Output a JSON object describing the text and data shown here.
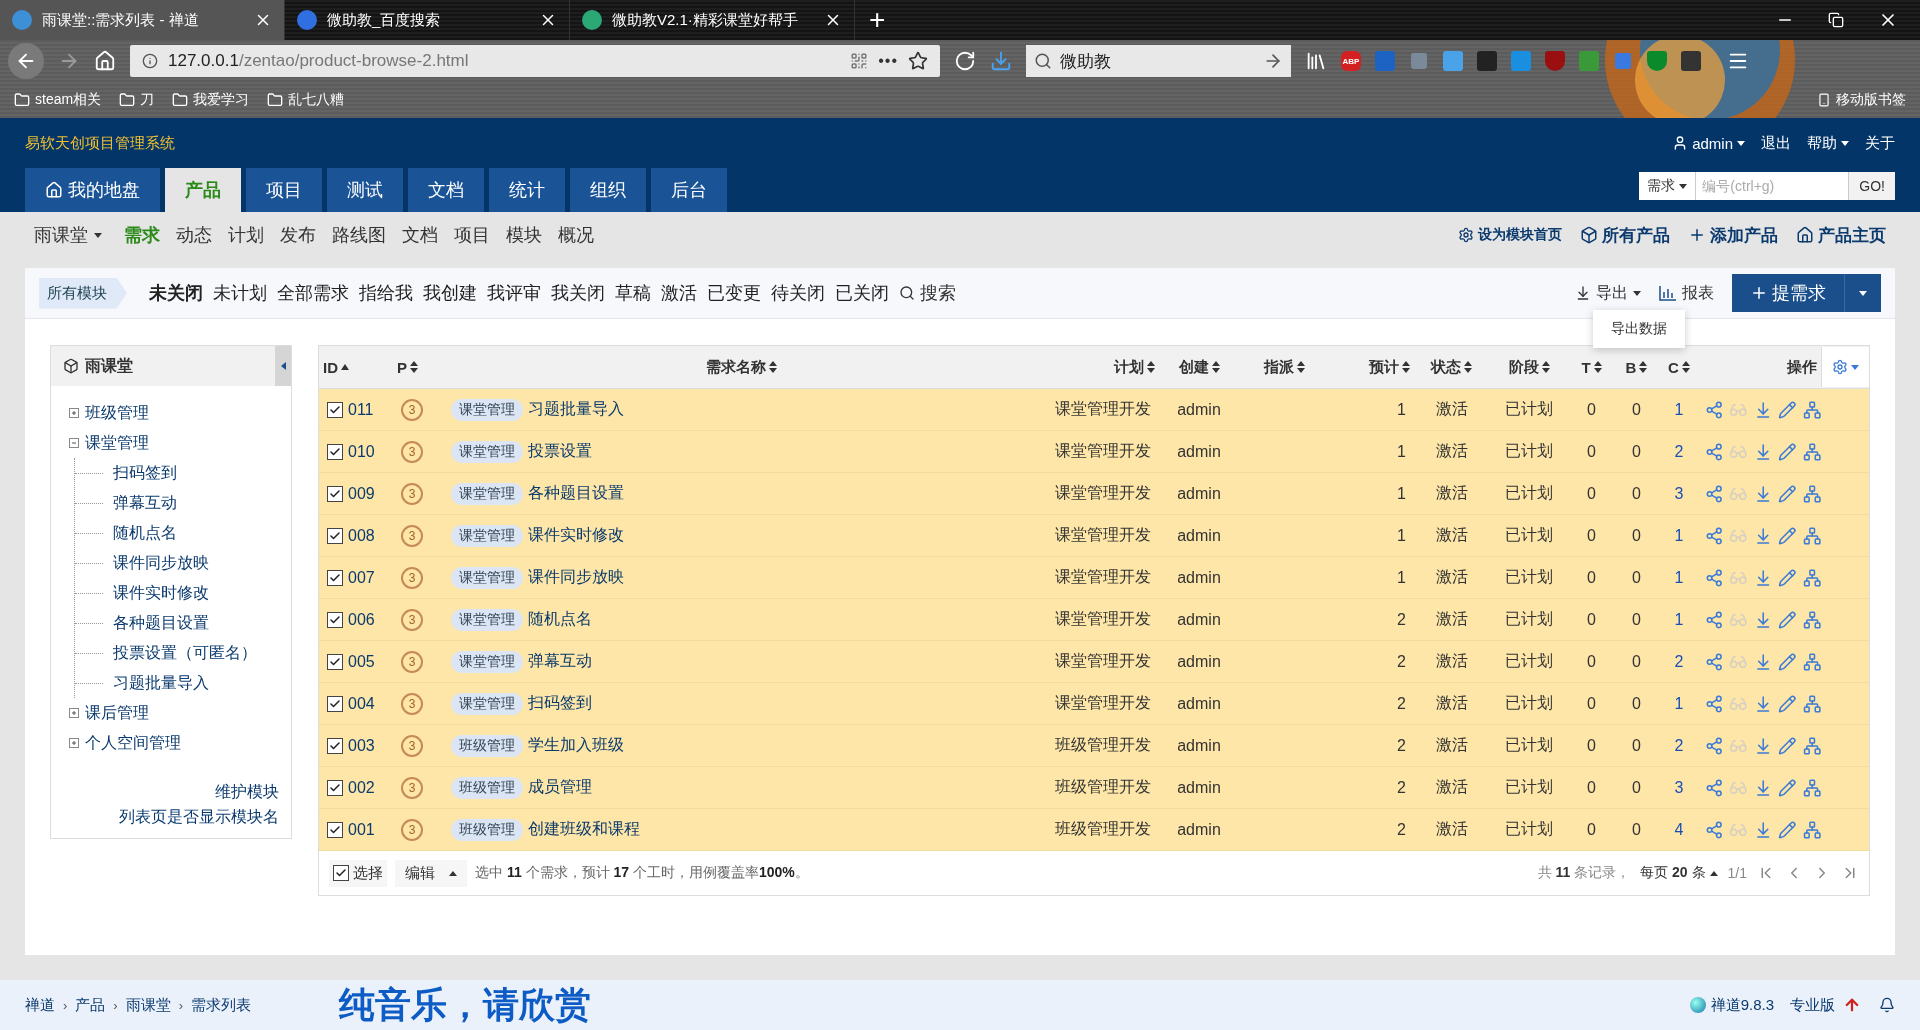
{
  "browser": {
    "tabs": [
      {
        "title": "雨课堂::需求列表 - 禅道",
        "selected": true,
        "color": "#3d8fd6"
      },
      {
        "title": "微助教_百度搜索",
        "selected": false,
        "color": "#2f6fe0"
      },
      {
        "title": "微助教V2.1·精彩课堂好帮手",
        "selected": false,
        "color": "#2aa876"
      }
    ],
    "new_tab": "+",
    "url_host": "127.0.0.1",
    "url_path": "/zentao/product-browse-2.html",
    "more": "•••",
    "search_value": "微助教",
    "extensions": [
      {
        "kind": "abp",
        "label": "ABP",
        "color": "#d32020"
      },
      {
        "kind": "tile",
        "color": "#1d63c4"
      },
      {
        "kind": "faded",
        "color": "#7a8a9a"
      },
      {
        "kind": "tile",
        "color": "#4aa3e8"
      },
      {
        "kind": "tile",
        "color": "#222222"
      },
      {
        "kind": "tile",
        "color": "#1a8fe0"
      },
      {
        "kind": "shield",
        "color": "#9a1010"
      },
      {
        "kind": "tile",
        "color": "#3a9a3a"
      },
      {
        "kind": "faded",
        "color": "#3a7ae0"
      },
      {
        "kind": "shield",
        "color": "#0a8a2a"
      },
      {
        "kind": "tile",
        "color": "#333333"
      }
    ],
    "bookmarks": [
      "steam相关",
      "刀",
      "我爱学习",
      "乱七八糟"
    ],
    "mobile_bookmarks": "移动版书签"
  },
  "app": {
    "title": "易软天创项目管理系统",
    "user": "admin",
    "user_links": [
      "退出",
      "帮助",
      "关于"
    ],
    "main_tabs": [
      {
        "label": "我的地盘",
        "selected": false,
        "kind": "home"
      },
      {
        "label": "产品",
        "selected": true
      },
      {
        "label": "项目",
        "selected": false
      },
      {
        "label": "测试",
        "selected": false
      },
      {
        "label": "文档",
        "selected": false
      },
      {
        "label": "统计",
        "selected": false
      },
      {
        "label": "组织",
        "selected": false
      },
      {
        "label": "后台",
        "selected": false
      }
    ],
    "quick_search": {
      "type": "需求",
      "placeholder": "编号(ctrl+g)",
      "button": "GO!"
    }
  },
  "subnav": {
    "product": "雨课堂",
    "items": [
      {
        "label": "需求",
        "selected": true
      },
      {
        "label": "动态",
        "selected": false
      },
      {
        "label": "计划",
        "selected": false
      },
      {
        "label": "发布",
        "selected": false
      },
      {
        "label": "路线图",
        "selected": false
      },
      {
        "label": "文档",
        "selected": false
      },
      {
        "label": "项目",
        "selected": false
      },
      {
        "label": "模块",
        "selected": false
      },
      {
        "label": "概况",
        "selected": false
      }
    ],
    "actions": [
      {
        "label": "设为模块首页",
        "kind": "settings"
      },
      {
        "label": "所有产品",
        "kind": "box"
      },
      {
        "label": "添加产品",
        "kind": "plus"
      },
      {
        "label": "产品主页",
        "kind": "home"
      }
    ]
  },
  "filter": {
    "module": "所有模块",
    "tabs": [
      {
        "label": "未关闭",
        "selected": true
      },
      {
        "label": "未计划",
        "selected": false
      },
      {
        "label": "全部需求",
        "selected": false
      },
      {
        "label": "指给我",
        "selected": false
      },
      {
        "label": "我创建",
        "selected": false
      },
      {
        "label": "我评审",
        "selected": false
      },
      {
        "label": "我关闭",
        "selected": false
      },
      {
        "label": "草稿",
        "selected": false
      },
      {
        "label": "激活",
        "selected": false
      },
      {
        "label": "已变更",
        "selected": false
      },
      {
        "label": "待关闭",
        "selected": false
      },
      {
        "label": "已关闭",
        "selected": false
      }
    ],
    "search": "搜索",
    "export": "导出",
    "export_menu": [
      "导出数据"
    ],
    "report": "报表",
    "create": "提需求"
  },
  "sidebar": {
    "title": "雨课堂",
    "tree": [
      {
        "label": "班级管理",
        "expanded": false
      },
      {
        "label": "课堂管理",
        "expanded": true,
        "children": [
          {
            "label": "扫码签到"
          },
          {
            "label": "弹幕互动"
          },
          {
            "label": "随机点名"
          },
          {
            "label": "课件同步放映"
          },
          {
            "label": "课件实时修改"
          },
          {
            "label": "各种题目设置"
          },
          {
            "label": "投票设置（可匿名）"
          },
          {
            "label": "习题批量导入"
          }
        ]
      },
      {
        "label": "课后管理",
        "expanded": false
      },
      {
        "label": "个人空间管理",
        "expanded": false
      }
    ],
    "links": [
      "维护模块",
      "列表页是否显示模块名"
    ]
  },
  "table": {
    "columns": [
      {
        "label": "ID",
        "sortable": true,
        "sorted_asc": true
      },
      {
        "label": "P",
        "sortable": true,
        "sorted_asc": false
      },
      {
        "label": "需求名称",
        "sortable": true,
        "sorted_asc": false
      },
      {
        "label": "计划",
        "sortable": true,
        "sorted_asc": false
      },
      {
        "label": "创建",
        "sortable": true,
        "sorted_asc": false
      },
      {
        "label": "指派",
        "sortable": true,
        "sorted_asc": false
      },
      {
        "label": "预计",
        "sortable": true,
        "sorted_asc": false
      },
      {
        "label": "状态",
        "sortable": true,
        "sorted_asc": false
      },
      {
        "label": "阶段",
        "sortable": true,
        "sorted_asc": false
      },
      {
        "label": "T",
        "sortable": true,
        "sorted_asc": false
      },
      {
        "label": "B",
        "sortable": true,
        "sorted_asc": false
      },
      {
        "label": "C",
        "sortable": true,
        "sorted_asc": false
      },
      {
        "label": "操作",
        "sortable": false
      }
    ],
    "rows": [
      {
        "id": "011",
        "checked": true,
        "selected": true,
        "priority": "3",
        "module": "课堂管理",
        "title": "习题批量导入",
        "plan": "课堂管理开发",
        "creator": "admin",
        "estimate": "1",
        "status": "激活",
        "stage": "已计划",
        "t": "0",
        "b": "0",
        "c": "1",
        "review_disabled": true
      },
      {
        "id": "010",
        "checked": true,
        "selected": true,
        "priority": "3",
        "module": "课堂管理",
        "title": "投票设置",
        "plan": "课堂管理开发",
        "creator": "admin",
        "estimate": "1",
        "status": "激活",
        "stage": "已计划",
        "t": "0",
        "b": "0",
        "c": "2",
        "review_disabled": true
      },
      {
        "id": "009",
        "checked": true,
        "selected": true,
        "priority": "3",
        "module": "课堂管理",
        "title": "各种题目设置",
        "plan": "课堂管理开发",
        "creator": "admin",
        "estimate": "1",
        "status": "激活",
        "stage": "已计划",
        "t": "0",
        "b": "0",
        "c": "3",
        "review_disabled": true
      },
      {
        "id": "008",
        "checked": true,
        "selected": true,
        "priority": "3",
        "module": "课堂管理",
        "title": "课件实时修改",
        "plan": "课堂管理开发",
        "creator": "admin",
        "estimate": "1",
        "status": "激活",
        "stage": "已计划",
        "t": "0",
        "b": "0",
        "c": "1",
        "review_disabled": true
      },
      {
        "id": "007",
        "checked": true,
        "selected": true,
        "priority": "3",
        "module": "课堂管理",
        "title": "课件同步放映",
        "plan": "课堂管理开发",
        "creator": "admin",
        "estimate": "1",
        "status": "激活",
        "stage": "已计划",
        "t": "0",
        "b": "0",
        "c": "1",
        "review_disabled": true
      },
      {
        "id": "006",
        "checked": true,
        "selected": true,
        "priority": "3",
        "module": "课堂管理",
        "title": "随机点名",
        "plan": "课堂管理开发",
        "creator": "admin",
        "estimate": "2",
        "status": "激活",
        "stage": "已计划",
        "t": "0",
        "b": "0",
        "c": "1",
        "review_disabled": true
      },
      {
        "id": "005",
        "checked": true,
        "selected": true,
        "priority": "3",
        "module": "课堂管理",
        "title": "弹幕互动",
        "plan": "课堂管理开发",
        "creator": "admin",
        "estimate": "2",
        "status": "激活",
        "stage": "已计划",
        "t": "0",
        "b": "0",
        "c": "2",
        "review_disabled": true
      },
      {
        "id": "004",
        "checked": true,
        "selected": true,
        "priority": "3",
        "module": "课堂管理",
        "title": "扫码签到",
        "plan": "课堂管理开发",
        "creator": "admin",
        "estimate": "2",
        "status": "激活",
        "stage": "已计划",
        "t": "0",
        "b": "0",
        "c": "1",
        "review_disabled": true
      },
      {
        "id": "003",
        "checked": true,
        "selected": true,
        "priority": "3",
        "module": "班级管理",
        "title": "学生加入班级",
        "plan": "班级管理开发",
        "creator": "admin",
        "estimate": "2",
        "status": "激活",
        "stage": "已计划",
        "t": "0",
        "b": "0",
        "c": "2",
        "review_disabled": true
      },
      {
        "id": "002",
        "checked": true,
        "selected": true,
        "priority": "3",
        "module": "班级管理",
        "title": "成员管理",
        "plan": "班级管理开发",
        "creator": "admin",
        "estimate": "2",
        "status": "激活",
        "stage": "已计划",
        "t": "0",
        "b": "0",
        "c": "3",
        "review_disabled": true
      },
      {
        "id": "001",
        "checked": true,
        "selected": true,
        "priority": "3",
        "module": "班级管理",
        "title": "创建班级和课程",
        "plan": "班级管理开发",
        "creator": "admin",
        "estimate": "2",
        "status": "激活",
        "stage": "已计划",
        "t": "0",
        "b": "0",
        "c": "4",
        "review_disabled": true
      }
    ],
    "footer": {
      "select_all": "选择",
      "select_all_checked": true,
      "edit": "编辑",
      "summary": "选中 **11** 个需求，预计 **17** 个工时，用例覆盖率**100%**。",
      "records": "共 **11** 条记录，",
      "per_page": "每页 **20** 条",
      "pages": "1/1"
    }
  },
  "status_bar": {
    "breadcrumb": [
      "禅道",
      "产品",
      "雨课堂",
      "需求列表"
    ],
    "separator": "›",
    "caption": "纯音乐，请欣赏",
    "version": "禅道9.8.3",
    "edition": "专业版"
  }
}
